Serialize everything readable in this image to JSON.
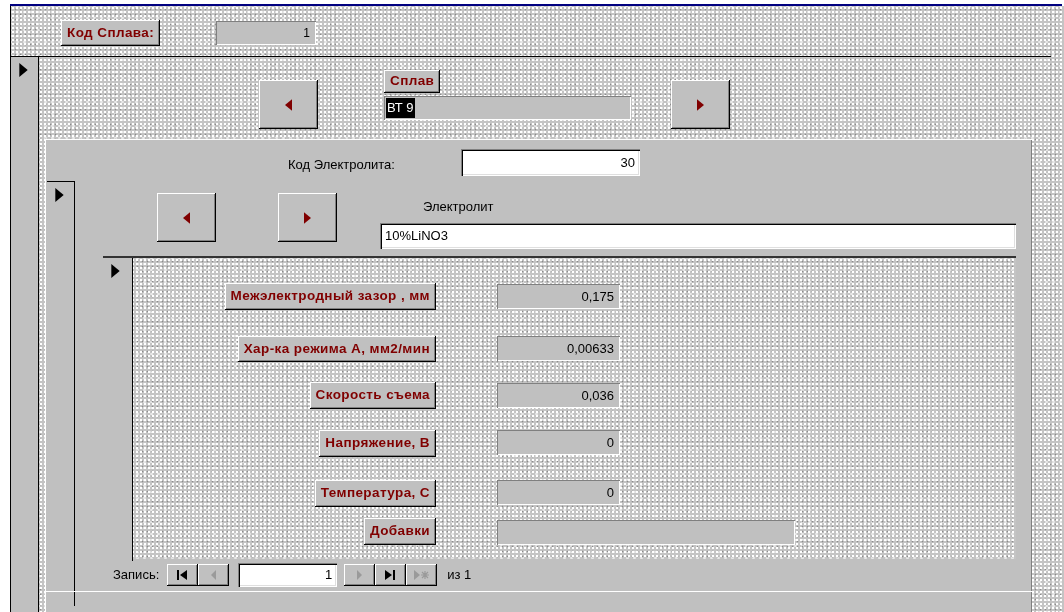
{
  "alloy_code": {
    "label": "Код Сплава:",
    "value": "1"
  },
  "alloy": {
    "label": "Сплав",
    "value": "ВТ 9",
    "value_selected": true
  },
  "electrolyte": {
    "code_label": "Код Электролита:",
    "code_value": "30",
    "label": "Электролит",
    "value": "10%LiNO3"
  },
  "parameters": [
    {
      "label": "Межэлектродный зазор , мм",
      "value": "0,175"
    },
    {
      "label": "Хар-ка режима А, мм2/мин",
      "value": "0,00633"
    },
    {
      "label": "Скорость съема",
      "value": "0,036"
    },
    {
      "label": "Напряжение, В",
      "value": "0"
    },
    {
      "label": "Температура, С",
      "value": "0"
    },
    {
      "label": "Добавки"
    }
  ],
  "navigator": {
    "label": "Запись:",
    "current": "1",
    "total": "из 1",
    "buttons": [
      {
        "kind": "first",
        "disabled": false
      },
      {
        "kind": "prev",
        "disabled": true
      },
      {
        "kind": "next",
        "disabled": true
      },
      {
        "kind": "last",
        "disabled": false
      },
      {
        "kind": "new",
        "disabled": true
      }
    ]
  }
}
